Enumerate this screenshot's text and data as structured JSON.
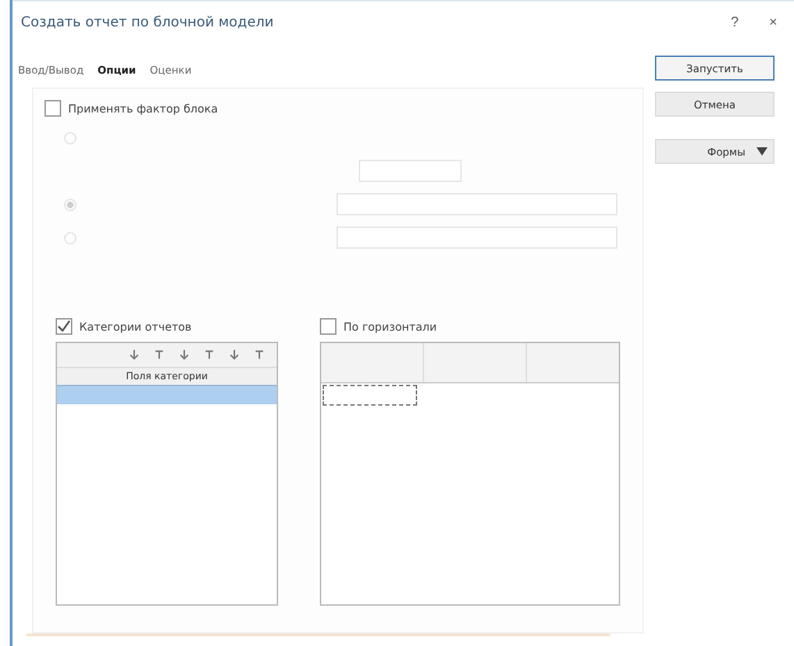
{
  "window": {
    "title": "Создать отчет по блочной модели",
    "help": "?",
    "close": "×"
  },
  "tabs": [
    {
      "label": "Ввод/Вывод",
      "selected": false
    },
    {
      "label": "Опции",
      "selected": true
    },
    {
      "label": "Оценки",
      "selected": false
    }
  ],
  "apply_block_factor": {
    "label": "Применять фактор блока",
    "checked": false
  },
  "block_options": [
    {
      "selected": false
    },
    {
      "selected": true
    },
    {
      "selected": false
    }
  ],
  "report_categories": {
    "label": "Категории отчетов",
    "checked": true,
    "header": "Поля категории",
    "rows": [
      {
        "selected": true
      }
    ]
  },
  "horizontal": {
    "label": "По горизонтали",
    "checked": false
  },
  "buttons": [
    {
      "label": "Запустить",
      "kind": "default"
    },
    {
      "label": "Отмена",
      "kind": "plain"
    },
    {
      "label": "Формы",
      "kind": "menu"
    }
  ]
}
